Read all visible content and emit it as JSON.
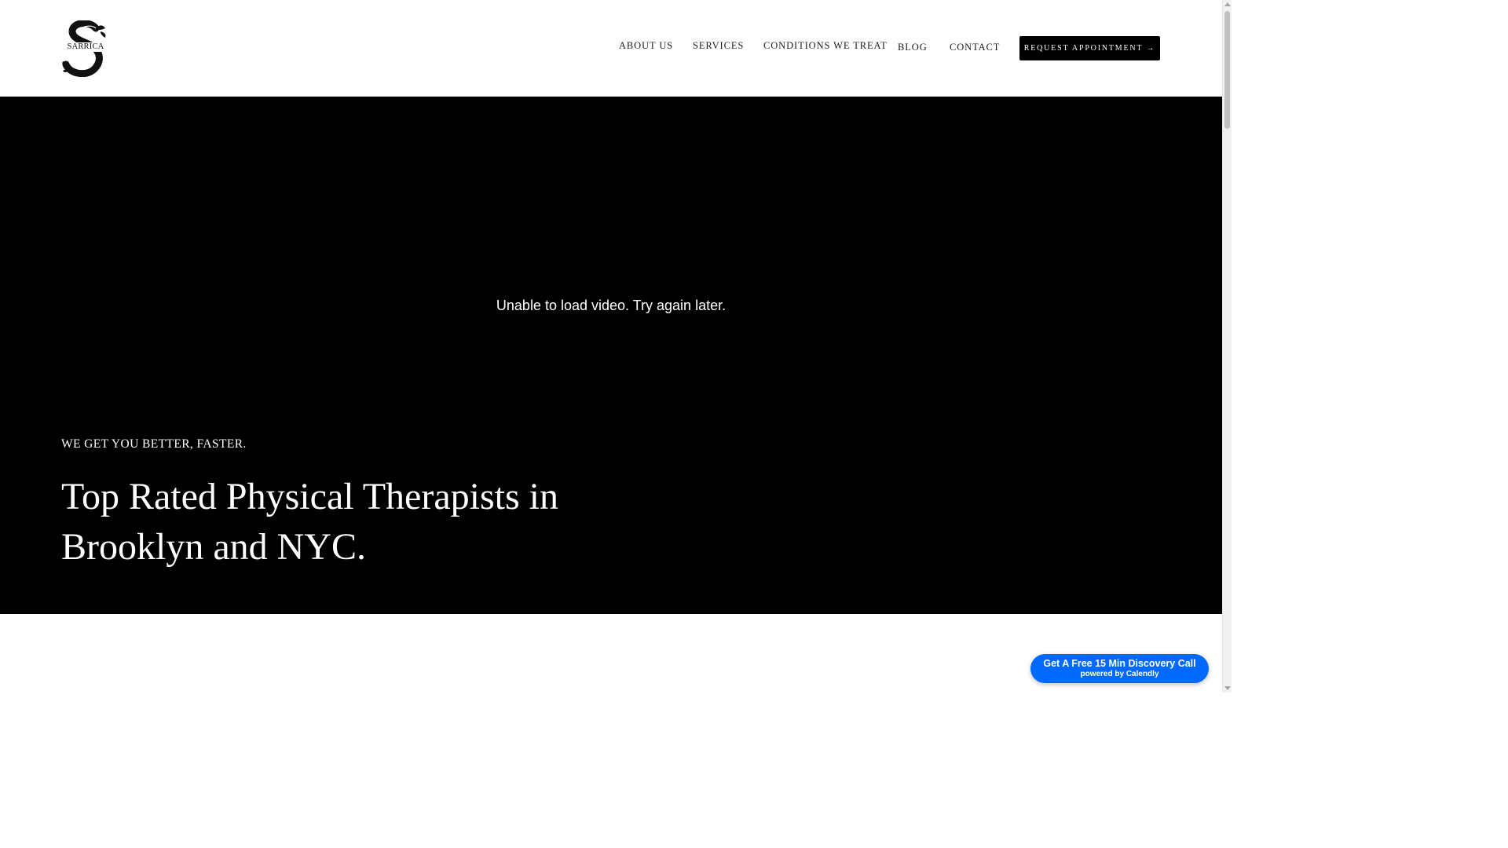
{
  "header": {
    "logo_text": "SARRICA",
    "nav": [
      {
        "label": "ABOUT US"
      },
      {
        "label": "SERVICES"
      },
      {
        "label": "CONDITIONS WE TREAT"
      },
      {
        "label": "BLOG"
      },
      {
        "label": "CONTACT"
      }
    ],
    "cta_label": "REQUEST APPOINTMENT →"
  },
  "hero": {
    "video_error": "Unable to load video. Try again later.",
    "tagline": "WE GET YOU BETTER, FASTER.",
    "title": "Top Rated Physical Therapists in Brooklyn and NYC."
  },
  "calendly": {
    "main_label": "Get A Free 15 Min Discovery Call",
    "sub_label": "powered by Calendly"
  },
  "icons": {
    "logo": "sarrica-monogram-logo"
  },
  "colors": {
    "hero_background": "#000000",
    "cta_background": "#000000",
    "calendly_blue": "#0069ff",
    "text_dark": "#1c1c1c"
  }
}
